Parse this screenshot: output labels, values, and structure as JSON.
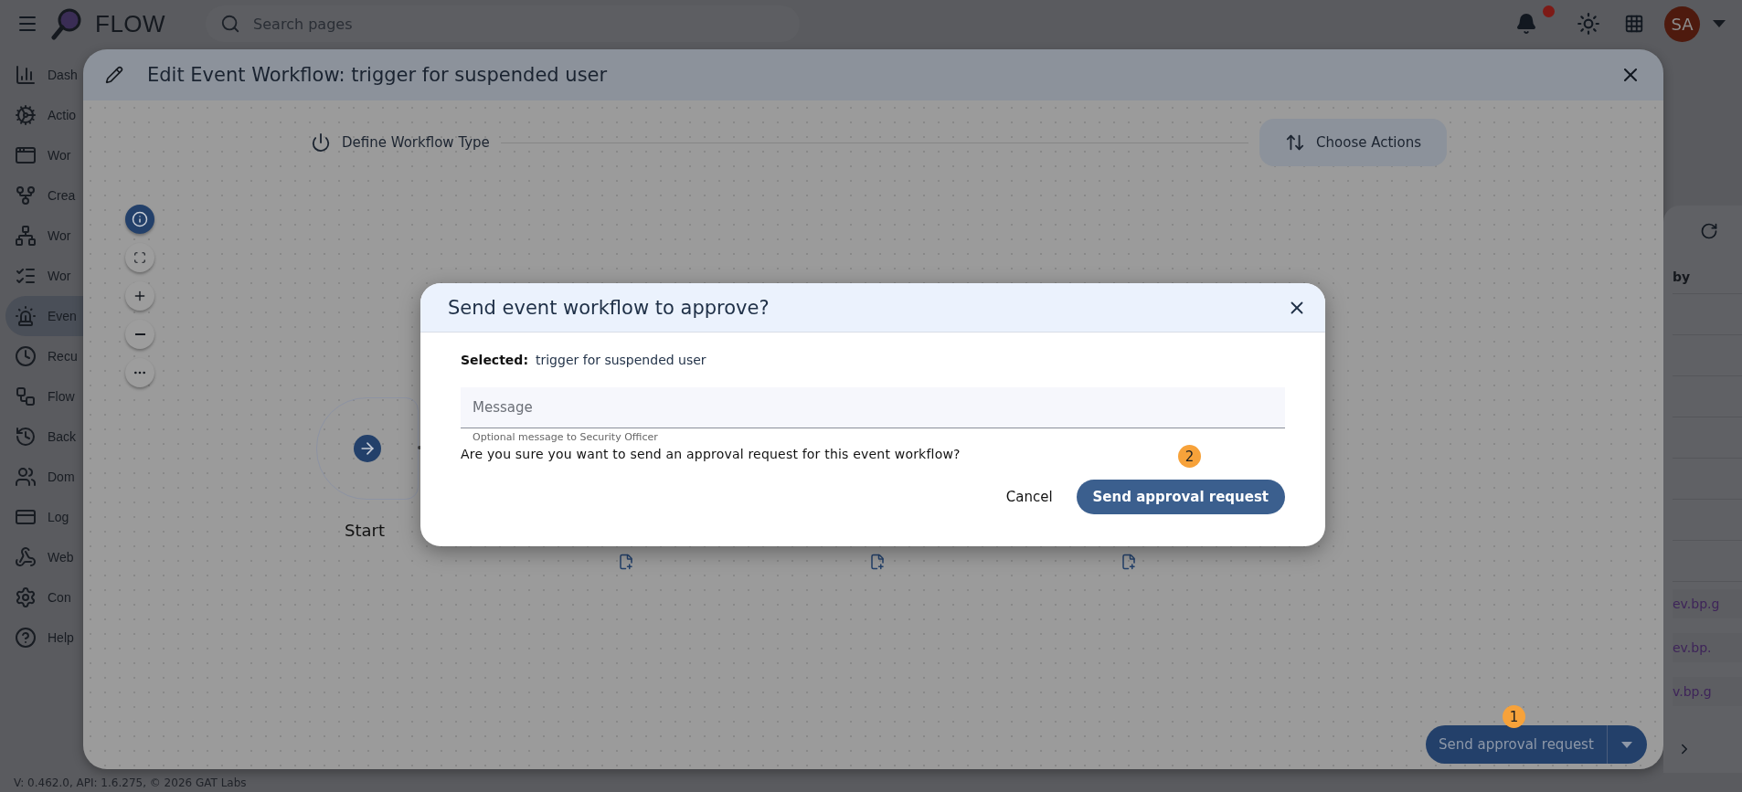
{
  "top_bar": {
    "app_name": "FLOW",
    "search": {
      "placeholder": "Search pages"
    },
    "notifications": {
      "unread": true
    },
    "avatar": {
      "initials": "SA"
    }
  },
  "sidebar": {
    "items": [
      {
        "label": "Dash",
        "selected": false
      },
      {
        "label": "Actio",
        "selected": false
      },
      {
        "label": "Wor",
        "selected": false
      },
      {
        "label": "Crea",
        "selected": false
      },
      {
        "label": "Wor",
        "selected": false
      },
      {
        "label": "Wor",
        "selected": false
      },
      {
        "label": "Even",
        "selected": true
      },
      {
        "label": "Recu",
        "selected": false
      },
      {
        "label": "Flow",
        "selected": false
      },
      {
        "label": "Back",
        "selected": false
      },
      {
        "label": "Dom",
        "selected": false
      },
      {
        "label": "Log",
        "selected": false
      },
      {
        "label": "Web",
        "selected": false
      },
      {
        "label": "Con",
        "selected": false
      },
      {
        "label": "Help",
        "selected": false
      }
    ]
  },
  "workflow_editor": {
    "title": "Edit Event Workflow: trigger for suspended user",
    "steps": [
      {
        "label": "Define Workflow Type",
        "selected": false
      },
      {
        "label": "Choose Actions",
        "selected": true
      }
    ],
    "start_node": {
      "label": "Start"
    },
    "submit_button": {
      "label": "Send approval request"
    },
    "badge": "1"
  },
  "background_table": {
    "column_header": "by",
    "rows": [
      "ev.bp.g",
      "ev.bp.",
      "v.bp.g"
    ]
  },
  "footer": {
    "version": "V: 0.462.0, API: 1.6.275, © 2026 GAT Labs"
  },
  "dialog": {
    "title": "Send event workflow to approve?",
    "selected_label": "Selected:",
    "selected_value": "trigger for suspended user",
    "message": {
      "placeholder": "Message",
      "helper": "Optional message to Security Officer"
    },
    "question": "Are you sure you want to send an approval request for this event workflow?",
    "cancel": "Cancel",
    "confirm": "Send approval request",
    "badge": "2"
  }
}
